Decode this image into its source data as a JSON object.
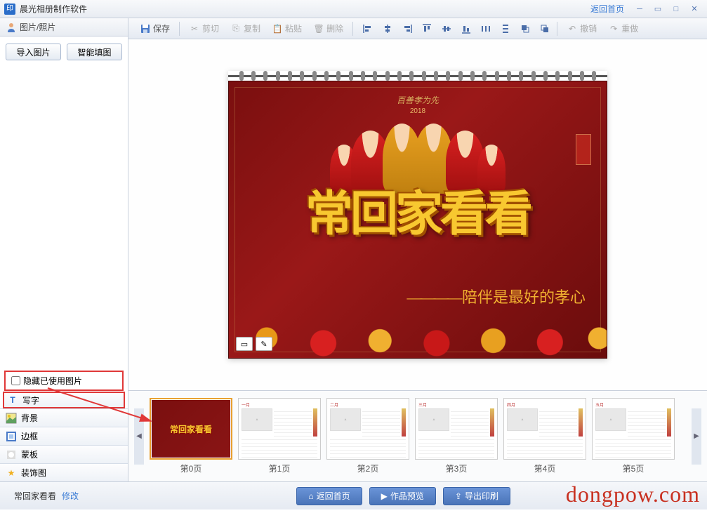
{
  "titlebar": {
    "app_icon": "印",
    "title": "晨光相册制作软件",
    "home_link": "返回首页"
  },
  "sidebar": {
    "header": "图片/照片",
    "import_btn": "导入图片",
    "smart_fill_btn": "智能填图",
    "hide_used_label": "隐藏已使用图片",
    "tabs": [
      {
        "label": "写字",
        "icon": "text-icon",
        "highlighted": true
      },
      {
        "label": "背景",
        "icon": "background-icon"
      },
      {
        "label": "边框",
        "icon": "border-icon"
      },
      {
        "label": "蒙板",
        "icon": "mask-icon"
      },
      {
        "label": "装饰图",
        "icon": "star-icon"
      }
    ]
  },
  "toolbar": {
    "save": "保存",
    "cut": "剪切",
    "copy": "复制",
    "paste": "粘贴",
    "delete": "删除",
    "undo": "撤销",
    "redo": "重做"
  },
  "calendar": {
    "top_text": "百善孝为先",
    "year": "2018",
    "main_title": "常回家看看",
    "subtitle": "陪伴是最好的孝心"
  },
  "thumbnails": [
    {
      "label": "第0页",
      "type": "cover",
      "selected": true
    },
    {
      "label": "第1页",
      "type": "month"
    },
    {
      "label": "第2页",
      "type": "month"
    },
    {
      "label": "第3页",
      "type": "month"
    },
    {
      "label": "第4页",
      "type": "month"
    },
    {
      "label": "第5页",
      "type": "month"
    }
  ],
  "bottom": {
    "project_name": "常回家看看",
    "edit_link": "修改",
    "home_btn": "返回首页",
    "preview_btn": "作品预览",
    "export_btn": "导出印刷"
  },
  "watermark": "dongpow.com"
}
